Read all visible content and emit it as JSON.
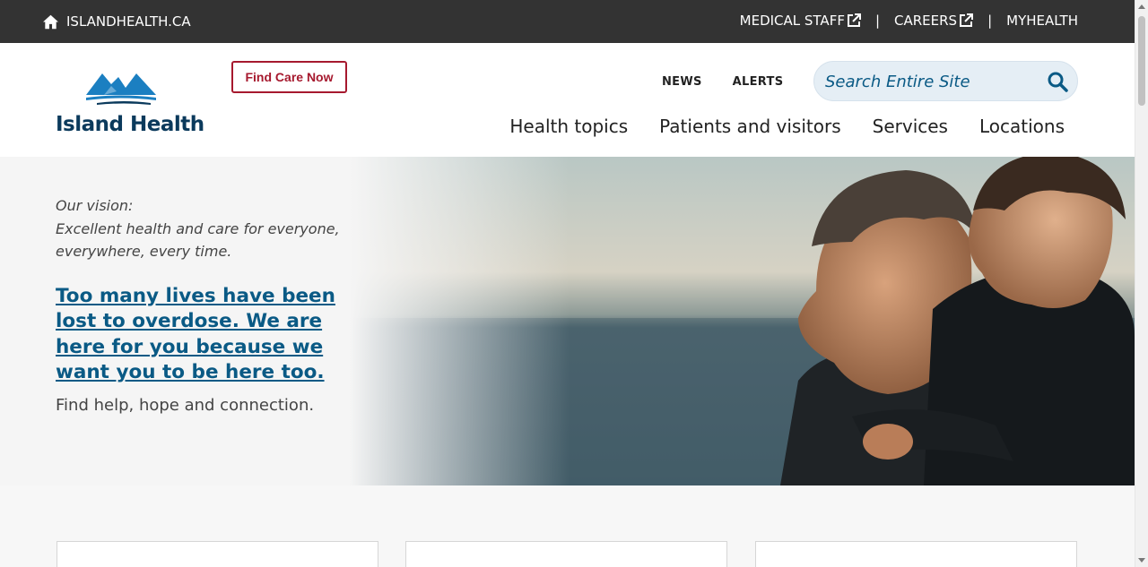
{
  "topbar": {
    "home_label": "ISLANDHEALTH.CA",
    "links": [
      {
        "label": "MEDICAL STAFF",
        "external": true
      },
      {
        "label": "CAREERS",
        "external": true
      },
      {
        "label": "MYHEALTH",
        "external": false
      }
    ],
    "separator": "|"
  },
  "header": {
    "logo_text": "Island Health",
    "find_care_label": "Find Care Now",
    "mini_nav": [
      "NEWS",
      "ALERTS"
    ],
    "search_placeholder": "Search Entire Site",
    "main_nav": [
      "Health topics",
      "Patients and visitors",
      "Services",
      "Locations"
    ]
  },
  "hero": {
    "vision_label": "Our vision:",
    "vision_text": "Excellent health and care for everyone, everywhere, every time.",
    "headline": "Too many lives have been lost to overdose. We are here for you because we want you to be here too.",
    "subline": "Find help, hope and connection."
  },
  "colors": {
    "topbar_bg": "#333333",
    "brand_navy": "#0b3a5c",
    "brand_blue": "#1b7fc1",
    "link_blue": "#0a5a85",
    "find_care_red": "#a6192e",
    "search_bg": "#e5eef5"
  },
  "icons": {
    "home": "home-icon",
    "external": "external-link-icon",
    "search": "search-icon"
  }
}
